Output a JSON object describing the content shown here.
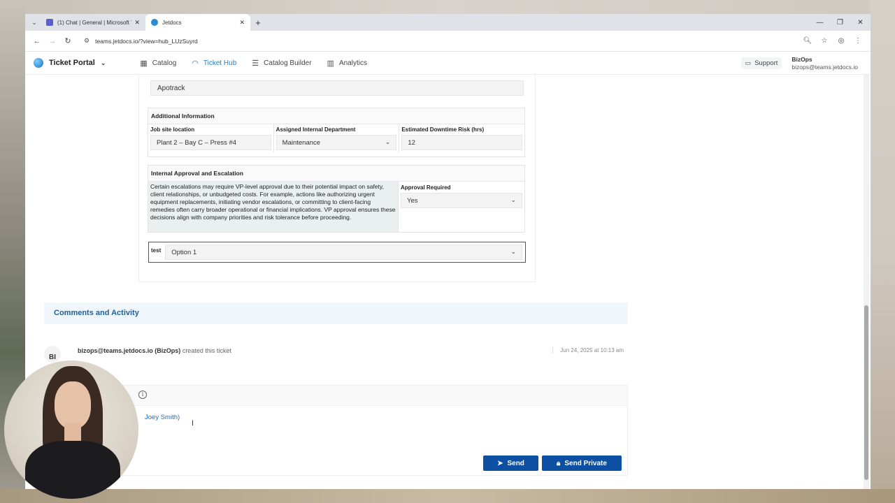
{
  "browser": {
    "tabs": [
      {
        "title": "(1) Chat | General | Microsoft Te",
        "active": false
      },
      {
        "title": "Jetdocs",
        "active": true
      }
    ],
    "url": "teams.jetdocs.io/?view=hub_LUzSuyrd"
  },
  "app": {
    "brand": "Ticket Portal",
    "nav": [
      {
        "label": "Catalog",
        "icon": "grid-icon",
        "active": false
      },
      {
        "label": "Ticket Hub",
        "icon": "ticket-icon",
        "active": true
      },
      {
        "label": "Catalog Builder",
        "icon": "builder-icon",
        "active": false
      },
      {
        "label": "Analytics",
        "icon": "chart-icon",
        "active": false
      }
    ],
    "support_label": "Support",
    "user_name": "BizOps",
    "user_email": "bizops@teams.jetdocs.io"
  },
  "form": {
    "readonly_value": "Apotrack",
    "additional": {
      "heading": "Additional Information",
      "job_site_label": "Job site location",
      "job_site_value": "Plant 2 – Bay C – Press #4",
      "department_label": "Assigned Internal Department",
      "department_value": "Maintenance",
      "downtime_label": "Estimated Downtime Risk (hrs)",
      "downtime_value": "12"
    },
    "approval": {
      "heading": "Internal Approval and Escalation",
      "description": "Certain escalations may require VP-level approval due to their potential impact on safety, client relationships, or unbudgeted costs. For example, actions like authorizing urgent equipment replacements, initiating vendor escalations, or committing to client-facing remedies often carry broader operational or financial implications. VP approval ensures these decisions align with company priorities and risk tolerance before proceeding.",
      "required_label": "Approval Required",
      "required_value": "Yes"
    },
    "test": {
      "label": "test",
      "value": "Option 1"
    }
  },
  "comments": {
    "heading": "Comments and Activity",
    "activity": {
      "avatar": "BI",
      "actor": "bizops@teams.jetdocs.io (BizOps)",
      "action": "created this ticket",
      "timestamp": "Jun 24, 2025 at 10:13 am"
    },
    "composer_mention": "Joey Smith)",
    "send_label": "Send",
    "send_private_label": "Send Private"
  },
  "colors": {
    "accent": "#1a7fc9",
    "button": "#0d4fa3",
    "comments_bg": "#f0f7fc"
  }
}
